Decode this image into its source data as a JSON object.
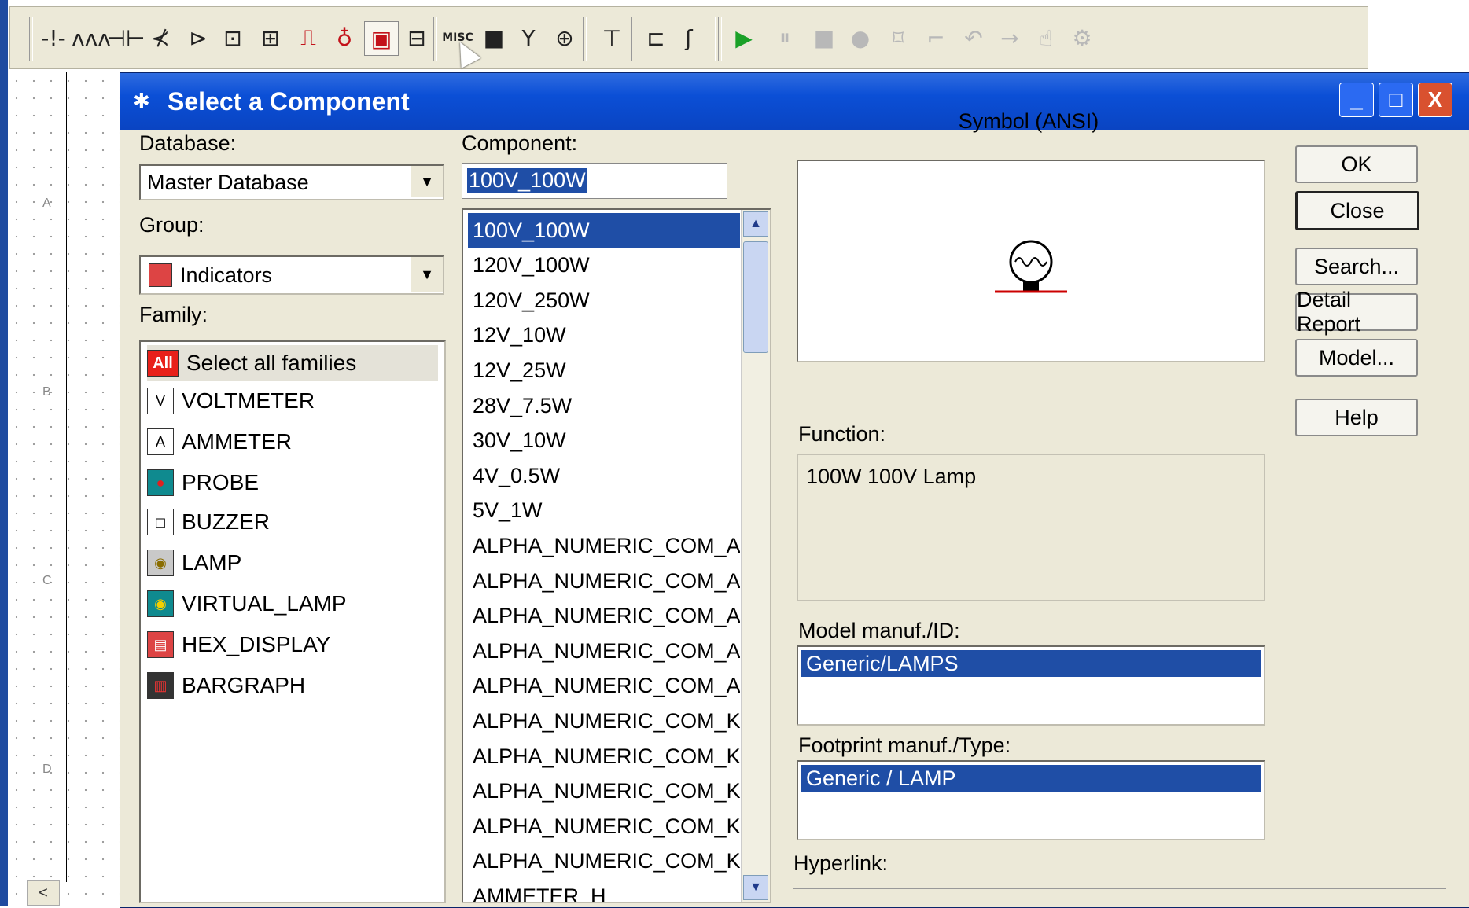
{
  "toolbar": {
    "buttons": [
      {
        "name": "ground-icon",
        "glyph": "-!-",
        "style": ""
      },
      {
        "name": "resistor-icon",
        "glyph": "ʌʌʌ",
        "style": ""
      },
      {
        "name": "diode-icon",
        "glyph": "⊣⊢",
        "style": ""
      },
      {
        "name": "transistor-icon",
        "glyph": "⊀",
        "style": ""
      },
      {
        "name": "analog-icon",
        "glyph": "⊳",
        "style": ""
      },
      {
        "name": "ttl-icon",
        "glyph": "⊡",
        "style": ""
      },
      {
        "name": "cmos-icon",
        "glyph": "⊞",
        "style": ""
      },
      {
        "name": "misc-digital-icon",
        "glyph": "⎍",
        "style": "red"
      },
      {
        "name": "mixed-icon",
        "glyph": "♁",
        "style": "red"
      },
      {
        "name": "indicator-icon",
        "glyph": "▣",
        "style": "red hot"
      },
      {
        "name": "power-component-icon",
        "glyph": "⊟",
        "style": ""
      },
      {
        "name": "misc-icon",
        "glyph": "MISC",
        "style": ""
      },
      {
        "name": "advanced-peripherals-icon",
        "glyph": "■",
        "style": ""
      },
      {
        "name": "rf-icon",
        "glyph": "Y",
        "style": ""
      },
      {
        "name": "electromechanical-icon",
        "glyph": "⊕",
        "style": ""
      },
      {
        "name": "place-bus-icon",
        "glyph": "⊤",
        "style": ""
      },
      {
        "name": "hierarchical-block-icon",
        "glyph": "⊏",
        "style": ""
      },
      {
        "name": "bus-icon",
        "glyph": "ʃ",
        "style": ""
      },
      {
        "name": "run-icon",
        "glyph": "▶",
        "style": "green"
      },
      {
        "name": "pause-icon",
        "glyph": "⏸",
        "style": "gray"
      },
      {
        "name": "stop-icon",
        "glyph": "■",
        "style": "gray"
      },
      {
        "name": "record-icon",
        "glyph": "●",
        "style": "gray"
      },
      {
        "name": "probe-tool-1-icon",
        "glyph": "⌑",
        "style": "gray"
      },
      {
        "name": "probe-tool-2-icon",
        "glyph": "⌐",
        "style": "gray"
      },
      {
        "name": "probe-tool-3-icon",
        "glyph": "↶",
        "style": "gray"
      },
      {
        "name": "probe-tool-4-icon",
        "glyph": "→",
        "style": "gray"
      },
      {
        "name": "probe-tool-5-icon",
        "glyph": "☝",
        "style": "gray"
      },
      {
        "name": "probe-tool-6-icon",
        "glyph": "⚙",
        "style": "gray"
      }
    ]
  },
  "canvas": {
    "row_letters": [
      "A",
      "B",
      "C",
      "D"
    ],
    "scroll_left": "<"
  },
  "dialog": {
    "title": "Select a Component",
    "window_buttons": {
      "minimize": "_",
      "maximize": "□",
      "close": "X"
    },
    "database_label": "Database:",
    "database_value": "Master Database",
    "group_label": "Group:",
    "group_value": "Indicators",
    "family_label": "Family:",
    "families": [
      {
        "label": "Select all families",
        "icon": "All",
        "name": "family-all",
        "icon_bg": "#e8201a",
        "icon_fg": "#fff"
      },
      {
        "label": "VOLTMETER",
        "icon": "V",
        "name": "family-voltmeter",
        "icon_bg": "#fff",
        "icon_fg": "#000"
      },
      {
        "label": "AMMETER",
        "icon": "A",
        "name": "family-ammeter",
        "icon_bg": "#fff",
        "icon_fg": "#000"
      },
      {
        "label": "PROBE",
        "icon": "●",
        "name": "family-probe",
        "icon_bg": "#0f8a8f",
        "icon_fg": "#e02020"
      },
      {
        "label": "BUZZER",
        "icon": "◻",
        "name": "family-buzzer",
        "icon_bg": "#fff",
        "icon_fg": "#000"
      },
      {
        "label": "LAMP",
        "icon": "◉",
        "name": "family-lamp",
        "icon_bg": "#c9c9c9",
        "icon_fg": "#8a6d00"
      },
      {
        "label": "VIRTUAL_LAMP",
        "icon": "◉",
        "name": "family-virtual-lamp",
        "icon_bg": "#0f8a8f",
        "icon_fg": "#f5d000"
      },
      {
        "label": "HEX_DISPLAY",
        "icon": "▤",
        "name": "family-hex-display",
        "icon_bg": "#d44",
        "icon_fg": "#fff"
      },
      {
        "label": "BARGRAPH",
        "icon": "▥",
        "name": "family-bargraph",
        "icon_bg": "#333",
        "icon_fg": "#e33"
      }
    ],
    "component_label": "Component:",
    "component_value": "100V_100W",
    "components": [
      "100V_100W",
      "120V_100W",
      "120V_250W",
      "12V_10W",
      "12V_25W",
      "28V_7.5W",
      "30V_10W",
      "4V_0.5W",
      "5V_1W",
      "ALPHA_NUMERIC_COM_A_",
      "ALPHA_NUMERIC_COM_A_",
      "ALPHA_NUMERIC_COM_A_",
      "ALPHA_NUMERIC_COM_A_",
      "ALPHA_NUMERIC_COM_A_",
      "ALPHA_NUMERIC_COM_K_",
      "ALPHA_NUMERIC_COM_K_",
      "ALPHA_NUMERIC_COM_K_",
      "ALPHA_NUMERIC_COM_K_",
      "ALPHA_NUMERIC_COM_K_",
      "AMMETER_H"
    ],
    "selected_component_index": 0,
    "symbol_label": "Symbol (ANSI)",
    "function_label": "Function:",
    "function_value": "100W 100V Lamp",
    "model_label": "Model manuf./ID:",
    "model_value": "Generic/LAMPS",
    "footprint_label": "Footprint manuf./Type:",
    "footprint_value": "Generic / LAMP",
    "hyperlink_label": "Hyperlink:",
    "buttons": {
      "ok": "OK",
      "close": "Close",
      "search": "Search...",
      "detail_report": "Detail Report",
      "model": "Model...",
      "help": "Help"
    }
  }
}
